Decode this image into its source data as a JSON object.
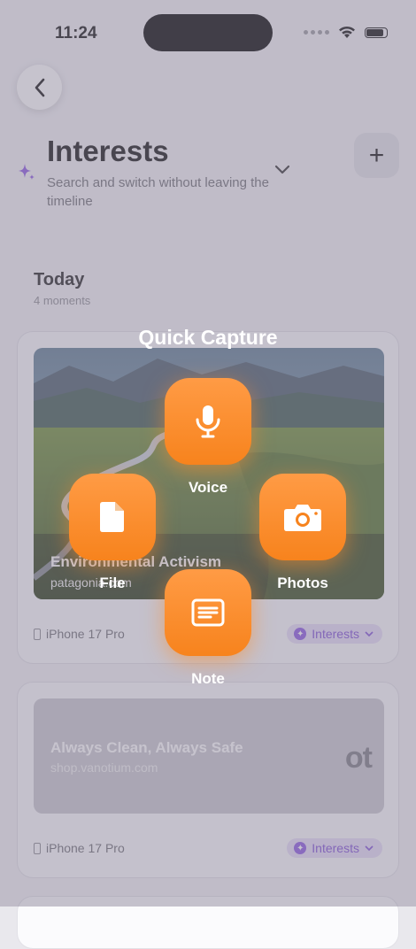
{
  "status": {
    "time": "11:24"
  },
  "header": {
    "title": "Interests",
    "subtitle": "Search and switch without leaving the timeline",
    "add_label": "+"
  },
  "section": {
    "title": "Today",
    "count": "4 moments"
  },
  "cards": [
    {
      "title": "Environmental Activism",
      "domain": "patagonia.com",
      "device": "iPhone 17 Pro",
      "tag": "Interests"
    },
    {
      "title": "Always Clean, Always Safe",
      "domain": "shop.vanotium.com",
      "logo_text": "ot",
      "device": "iPhone 17 Pro",
      "tag": "Interests"
    }
  ],
  "quick_capture": {
    "title": "Quick Capture",
    "actions": {
      "voice": "Voice",
      "file": "File",
      "photos": "Photos",
      "note": "Note"
    },
    "accent": "#f7831d"
  },
  "icons": [
    "back-chevron-icon",
    "sparkle-icon",
    "chevron-down-icon",
    "plus-icon",
    "microphone-icon",
    "file-icon",
    "camera-icon",
    "note-icon",
    "phone-icon"
  ]
}
